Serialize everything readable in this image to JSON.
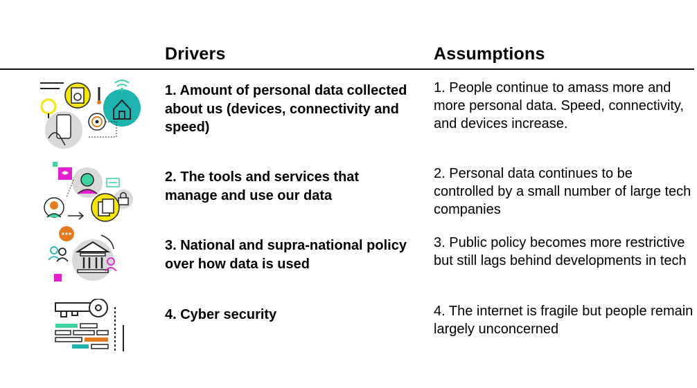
{
  "headers": {
    "drivers": "Drivers",
    "assumptions": "Assumptions"
  },
  "rows": [
    {
      "icon": "connected-devices-icon",
      "driver": "1. Amount of personal data collected about us (devices, connectivity and speed)",
      "assumption": "1. People continue to amass more and more personal data. Speed, connectivity, and devices increase."
    },
    {
      "icon": "data-services-icon",
      "driver": "2. The tools and services that manage and use our data",
      "assumption": "2. Personal data continues to be controlled by a small number of large tech companies"
    },
    {
      "icon": "government-policy-icon",
      "driver": "3. National and supra-national policy over how data is used",
      "assumption": "3. Public policy becomes more restrictive but still lags behind developments in tech"
    },
    {
      "icon": "key-security-icon",
      "driver": "4.  Cyber security",
      "assumption": "4. The internet is fragile but people remain largely unconcerned"
    }
  ],
  "colors": {
    "teal": "#1fb3b0",
    "yellow": "#f5e60a",
    "magenta": "#e41fd0",
    "green": "#3fd29c",
    "orange": "#e27b1f",
    "light_gray": "#d9d9d9"
  }
}
